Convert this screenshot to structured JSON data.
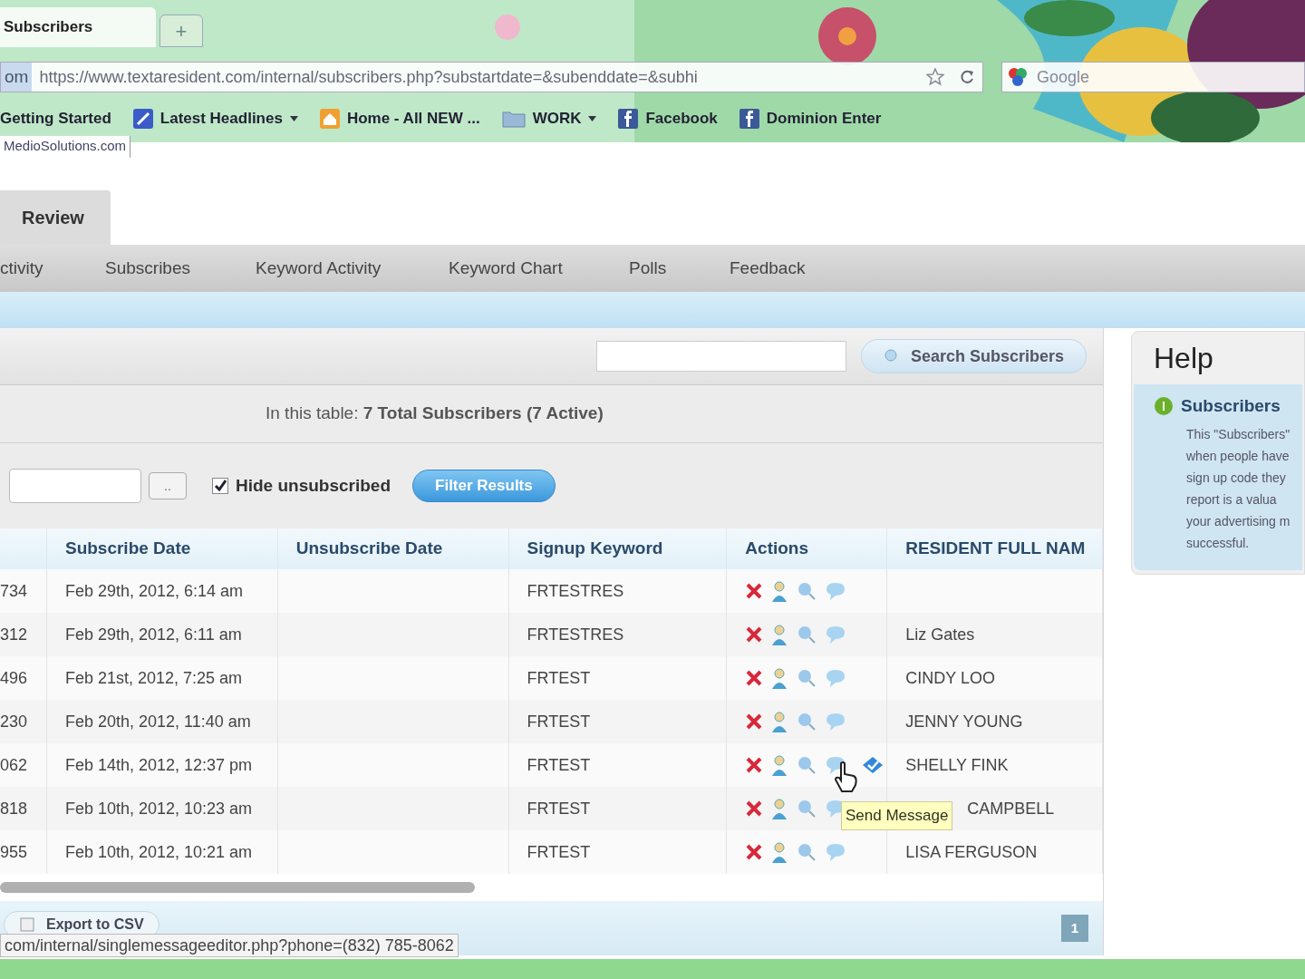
{
  "browser": {
    "tabs": [
      {
        "label": "Subscribers",
        "selected": true
      }
    ],
    "new_tab": "+",
    "address_prefix": "om",
    "url": "https://www.textaresident.com/internal/subscribers.php?substartdate=&subenddate=&subhi",
    "search_placeholder": "Google",
    "bookmarks": [
      {
        "label": "Getting Started",
        "kind": "plain"
      },
      {
        "label": "Latest Headlines",
        "kind": "feed"
      },
      {
        "label": "Home - All NEW ...",
        "kind": "home"
      },
      {
        "label": "WORK",
        "kind": "folder"
      },
      {
        "label": "Facebook",
        "kind": "facebook"
      },
      {
        "label": "Dominion Enter",
        "kind": "facebook"
      }
    ],
    "site_line": "MedioSolutions.com"
  },
  "page": {
    "section_tab": "Review",
    "nav": [
      {
        "label": "ctivity"
      },
      {
        "label": "Subscribes"
      },
      {
        "label": "Keyword Activity"
      },
      {
        "label": "Keyword Chart"
      },
      {
        "label": "Polls"
      },
      {
        "label": "Feedback"
      }
    ],
    "search_button": "Search Subscribers",
    "summary": "In this table: **7 Total Subscribers (7 Active)**",
    "date_button": "..",
    "hide_unsubscribed": {
      "label": "Hide unsubscribed",
      "checked": true
    },
    "filter_button": "Filter Results",
    "table": {
      "columns": [
        "",
        "Subscribe Date",
        "Unsubscribe Date",
        "Signup Keyword",
        "Actions",
        "RESIDENT FULL NAM"
      ],
      "rows": [
        {
          "column_1": "734",
          "subscribe_date": "Feb 29th, 2012, 6:14 am",
          "keyword": "FRTESTRES",
          "name": "",
          "verified": false
        },
        {
          "column_1": "312",
          "subscribe_date": "Feb 29th, 2012, 6:11 am",
          "keyword": "FRTESTRES",
          "name": "Liz Gates",
          "verified": false
        },
        {
          "column_1": "496",
          "subscribe_date": "Feb 21st, 2012, 7:25 am",
          "keyword": "FRTEST",
          "name": "CINDY LOO",
          "verified": false
        },
        {
          "column_1": "230",
          "subscribe_date": "Feb 20th, 2012, 11:40 am",
          "keyword": "FRTEST",
          "name": "JENNY YOUNG",
          "verified": false
        },
        {
          "column_1": "062",
          "subscribe_date": "Feb 14th, 2012, 12:37 pm",
          "keyword": "FRTEST",
          "name": "SHELLY FINK",
          "verified": true
        },
        {
          "column_1": "818",
          "subscribe_date": "Feb 10th, 2012, 10:23 am",
          "keyword": "FRTEST",
          "name": "CAMPBELL",
          "verified": false
        },
        {
          "column_1": "955",
          "subscribe_date": "Feb 10th, 2012, 10:21 am",
          "keyword": "FRTEST",
          "name": "LISA FERGUSON",
          "verified": false
        }
      ]
    },
    "tooltip": "Send Message",
    "export_button": "Export to CSV",
    "page_number": "1"
  },
  "help": {
    "title": "Help",
    "heading": "Subscribers",
    "lines": [
      "This \"Subscribers\"",
      "when people have",
      "sign up code they",
      "report is a valua",
      "your advertising m",
      "successful."
    ]
  },
  "status_bar": "com/internal/singlemessageeditor.php?phone=(832) 785-8062"
}
